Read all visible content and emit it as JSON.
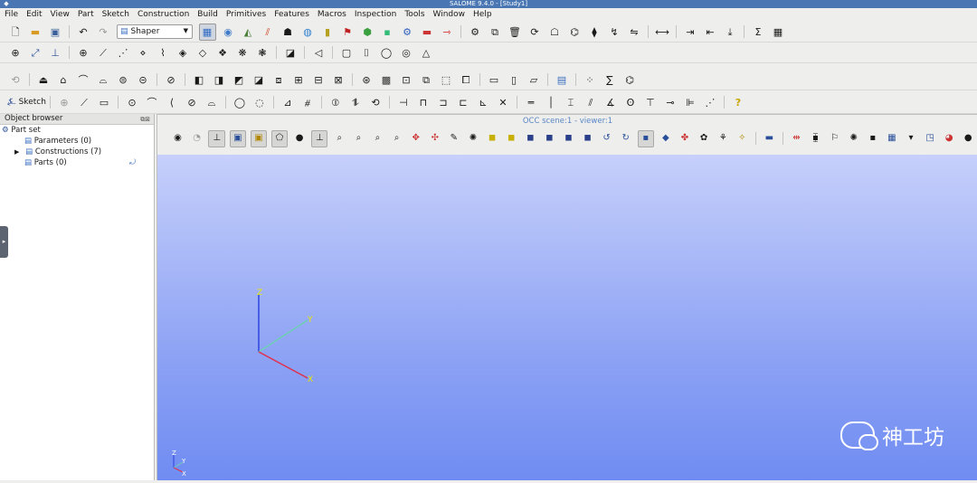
{
  "window": {
    "title": "SALOME 9.4.0 - [Study1]"
  },
  "menu": [
    "File",
    "Edit",
    "View",
    "Part",
    "Sketch",
    "Construction",
    "Build",
    "Primitives",
    "Features",
    "Macros",
    "Inspection",
    "Tools",
    "Window",
    "Help"
  ],
  "toolbar": {
    "module_combo_value": "Shaper",
    "sketch_label": "Sketch"
  },
  "object_browser": {
    "title": "Object browser",
    "root": "Part set",
    "items": [
      {
        "label": "Parameters (0)"
      },
      {
        "label": "Constructions (7)"
      },
      {
        "label": "Parts (0)"
      }
    ]
  },
  "viewer": {
    "title": "OCC scene:1 - viewer:1",
    "axis_labels": {
      "x": "X",
      "y": "Y",
      "z": "Z"
    }
  },
  "watermark": {
    "text": "神工坊"
  },
  "colors": {
    "accent": "#4a77b4",
    "viewer_top": "#c7d0fb",
    "viewer_bottom": "#6f8cf2",
    "axis_x": "#e0304a",
    "axis_y": "#6ecfb4",
    "axis_z": "#2c44e0"
  }
}
